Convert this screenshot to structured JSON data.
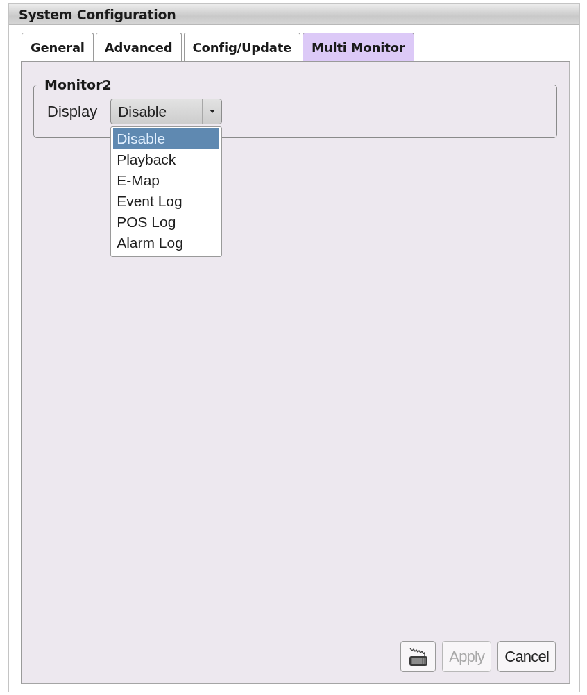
{
  "window": {
    "title": "System Configuration"
  },
  "tabs": [
    {
      "label": "General",
      "selected": false
    },
    {
      "label": "Advanced",
      "selected": false
    },
    {
      "label": "Config/Update",
      "selected": false
    },
    {
      "label": "Multi Monitor",
      "selected": true
    }
  ],
  "group": {
    "title": "Monitor2",
    "display": {
      "label": "Display",
      "value": "Disable",
      "expanded": true,
      "options": [
        {
          "label": "Disable",
          "selected": true
        },
        {
          "label": "Playback",
          "selected": false
        },
        {
          "label": "E-Map",
          "selected": false
        },
        {
          "label": "Event Log",
          "selected": false
        },
        {
          "label": "POS Log",
          "selected": false
        },
        {
          "label": "Alarm Log",
          "selected": false
        }
      ]
    }
  },
  "buttons": [
    {
      "kind": "keyboard",
      "disabled": false
    },
    {
      "kind": "text",
      "label": "Apply",
      "disabled": true
    },
    {
      "kind": "text",
      "label": "Cancel",
      "disabled": false
    }
  ]
}
